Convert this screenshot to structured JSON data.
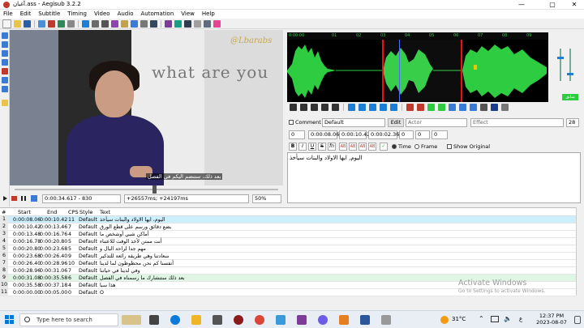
{
  "window": {
    "title": "آغبان.ass - Aegisub 3.2.2",
    "minimize": "—",
    "maximize": "▢",
    "close": "✕"
  },
  "menu": [
    "File",
    "Edit",
    "Subtitle",
    "Timing",
    "Video",
    "Audio",
    "Automation",
    "View",
    "Help"
  ],
  "video": {
    "handwriting": "what are you",
    "watermark": "@Lbarabs",
    "subtitle_overlay": "بعد ذلك، ستنضم اليكم في الفصل"
  },
  "video_controls": {
    "time_frame": "0:00:34.617 - 830",
    "offset": "+26557ms; +24197ms",
    "zoom": "50%"
  },
  "audio": {
    "ruler": [
      "0:00:00",
      "01",
      "02",
      "03",
      "04",
      "05",
      "06",
      "07",
      "08",
      "09"
    ],
    "commit_label": "سابق"
  },
  "edit": {
    "comment_label": "Comment",
    "style_value": "Default",
    "edit_button": "Edit",
    "actor_placeholder": "Actor",
    "effect_placeholder": "Effect",
    "char_count": "28",
    "layer": "0",
    "start_time": "0:00:08.06",
    "end_time": "0:00:10.42",
    "duration": "0:00:02.36",
    "margin_l": "0",
    "margin_r": "0",
    "margin_v": "0",
    "time_label": "Time",
    "frame_label": "Frame",
    "show_original_label": "Show Original",
    "text_value": "اليوم, ايها الاولاد والبنات سيأخذ"
  },
  "grid": {
    "headers": [
      "#",
      "Start",
      "End",
      "CPS",
      "Style",
      "Text"
    ],
    "rows": [
      {
        "n": "1",
        "start": "0:00:08.06",
        "end": "0:00:10.42",
        "cps": "11",
        "style": "Default",
        "text": "اليوم، ايها الاولاد والبنات سيأخذ"
      },
      {
        "n": "2",
        "start": "0:00:10.42",
        "end": "0:00:13.46",
        "cps": "7",
        "style": "Default",
        "text": "بضع دقائق ورسم على قطع الورق"
      },
      {
        "n": "3",
        "start": "0:00:13.48",
        "end": "0:00:16.76",
        "cps": "4",
        "style": "Default",
        "text": "أماكن شبي أوشخص ما"
      },
      {
        "n": "4",
        "start": "0:00:16.78",
        "end": "0:00:20.80",
        "cps": "5",
        "style": "Default",
        "text": "أنت ممتن لأخذ الوقت للاعتناء"
      },
      {
        "n": "5",
        "start": "0:00:20.80",
        "end": "0:00:23.68",
        "cps": "5",
        "style": "Default",
        "text": "مهم جدا لراحة البال و"
      },
      {
        "n": "6",
        "start": "0:00:23.68",
        "end": "0:00:26.40",
        "cps": "9",
        "style": "Default",
        "text": "سعادتنا وهي طريقة رائعة للتذكير"
      },
      {
        "n": "7",
        "start": "0:00:26.40",
        "end": "0:00:28.96",
        "cps": "10",
        "style": "Default",
        "text": "أنفسنا كم نحن محظوظون لما لدينا"
      },
      {
        "n": "8",
        "start": "0:00:28.96",
        "end": "0:00:31.06",
        "cps": "7",
        "style": "Default",
        "text": "وفي لدينا في حياتنا"
      },
      {
        "n": "9",
        "start": "0:00:31.08",
        "end": "0:00:35.58",
        "cps": "6",
        "style": "Default",
        "text": "بعد ذلك ستنشارك ما رسمناه في الفصل"
      },
      {
        "n": "10",
        "start": "0:00:35.58",
        "end": "0:00:37.18",
        "cps": "4",
        "style": "Default",
        "text": "هذا سبا"
      },
      {
        "n": "11",
        "start": "0:00:00.00",
        "end": "0:00:05.00",
        "cps": "0",
        "style": "Default",
        "text": "O"
      }
    ]
  },
  "activate": {
    "line1": "Activate Windows",
    "line2": "Go to Settings to activate Windows."
  },
  "taskbar": {
    "search_placeholder": "Type here to search",
    "weather": "31°C",
    "time": "12:37 PM",
    "date": "2023-08-07"
  }
}
